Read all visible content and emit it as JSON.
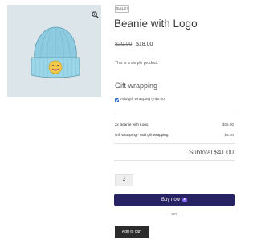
{
  "product": {
    "sale_badge": "SALE!",
    "title": "Beanie with Logo",
    "price_original": "$20.00",
    "price_sale": "$18.00",
    "description": "This is a simple product."
  },
  "gift_wrapping": {
    "title": "Gift wrapping",
    "checkbox_label": "Add gift wrapping (+$5.00)",
    "checked": true
  },
  "summary": {
    "rows": [
      {
        "label": "2x Beanie with Logo",
        "value": "$36.00"
      },
      {
        "label": "Gift wrapping - Add gift wrapping",
        "value": "$5.00"
      }
    ],
    "subtotal": "Subtotal $41.00"
  },
  "quantity": {
    "value": "2"
  },
  "buttons": {
    "buy_now": "Buy now",
    "or_separator": "— OR —",
    "add_to_cart": "Add to cart"
  },
  "icons": {
    "zoom": "magnifier-icon",
    "buy_now": "play-circle-icon"
  },
  "colors": {
    "buy_now_bg": "#272262",
    "buy_now_icon": "#8a68ff",
    "add_to_cart_bg": "#2b2b2b",
    "gallery_bg": "#dce6ea",
    "checkbox": "#2f6fd8"
  }
}
